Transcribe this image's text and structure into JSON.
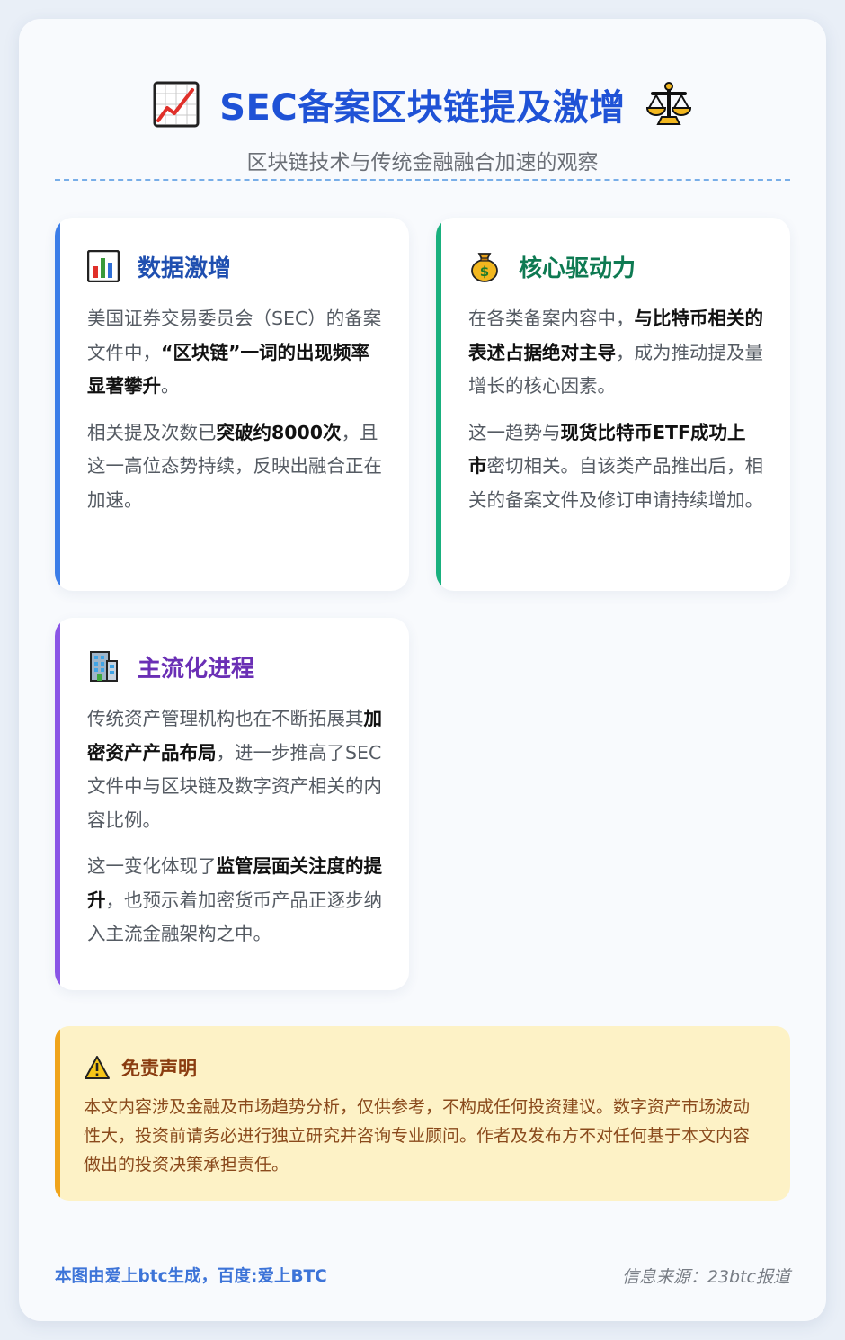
{
  "header": {
    "title": "SEC备案区块链提及激增",
    "subtitle": "区块链技术与传统金融融合加速的观察",
    "left_icon": "chart-increasing-icon",
    "right_icon": "balance-scale-icon"
  },
  "cards": [
    {
      "icon": "bar-chart-icon",
      "title": "数据激增",
      "p1": [
        {
          "t": "美国证券交易委员会（SEC）的备案文件中，",
          "b": false
        },
        {
          "t": "“区块链”一词的出现频率显著攀升",
          "b": true
        },
        {
          "t": "。",
          "b": false
        }
      ],
      "p2": [
        {
          "t": "相关提及次数已",
          "b": false
        },
        {
          "t": "突破约8000次",
          "b": true
        },
        {
          "t": "，且这一高位态势持续，反映出融合正在加速。",
          "b": false
        }
      ]
    },
    {
      "icon": "money-bag-icon",
      "title": "核心驱动力",
      "p1": [
        {
          "t": "在各类备案内容中，",
          "b": false
        },
        {
          "t": "与比特币相关的表述占据绝对主导",
          "b": true
        },
        {
          "t": "，成为推动提及量增长的核心因素。",
          "b": false
        }
      ],
      "p2": [
        {
          "t": "这一趋势与",
          "b": false
        },
        {
          "t": "现货比特币ETF成功上市",
          "b": true
        },
        {
          "t": "密切相关。自该类产品推出后，相关的备案文件及修订申请持续增加。",
          "b": false
        }
      ]
    },
    {
      "icon": "office-building-icon",
      "title": "主流化进程",
      "p1": [
        {
          "t": "传统资产管理机构也在不断拓展其",
          "b": false
        },
        {
          "t": "加密资产产品布局",
          "b": true
        },
        {
          "t": "，进一步推高了SEC文件中与区块链及数字资产相关的内容比例。",
          "b": false
        }
      ],
      "p2": [
        {
          "t": "这一变化体现了",
          "b": false
        },
        {
          "t": "监管层面关注度的提升",
          "b": true
        },
        {
          "t": "，也预示着加密货币产品正逐步纳入主流金融架构之中。",
          "b": false
        }
      ]
    }
  ],
  "disclaimer": {
    "icon": "warning-icon",
    "title": "免责声明",
    "text": "本文内容涉及金融及市场趋势分析，仅供参考，不构成任何投资建议。数字资产市场波动性大，投资前请务必进行独立研究并咨询专业顾问。作者及发布方不对任何基于本文内容做出的投资决策承担责任。"
  },
  "footer": {
    "left": "本图由爱上btc生成，百度:爱上BTC",
    "right": "信息来源：23btc报道"
  },
  "colors": {
    "title": "#1f52d6",
    "card1_accent": "#3b7de8",
    "card2_accent": "#19b07e",
    "card3_accent": "#8a55e6",
    "disclaimer_accent": "#f0a41c"
  }
}
